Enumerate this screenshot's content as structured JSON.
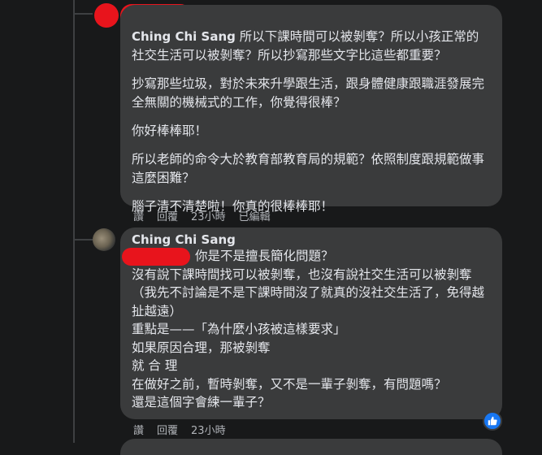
{
  "comments": [
    {
      "author": "Ching Chi Sang",
      "paragraphs": [
        "所以下課時間可以被剝奪？所以小孩正常的社交生活可以被剝奪？所以抄寫那些文字比這些都重要？",
        "抄寫那些垃圾，對於未來升學跟生活，跟身體健康跟職涯發展完全無關的機械式的工作，你覺得很棒？",
        "你好棒棒耶！",
        "所以老師的命令大於教育部教育局的規範？依照制度跟規範做事這麼困難？",
        "腦子清不清楚啦！你真的很棒棒耶！"
      ],
      "actions": {
        "like": "讚",
        "reply": "回覆",
        "time": "23小時",
        "edited": "已編輯"
      }
    },
    {
      "author": "Ching Chi Sang",
      "lines": [
        "你是不是擅長簡化問題？",
        "沒有說下課時間找可以被剝奪，也沒有說社交生活可以被剝奪（我先不討論是不是下課時間沒了就真的沒社交生活了，免得越扯越遠）",
        "重點是——「為什麼小孩被這樣要求」",
        "如果原因合理，那被剝奪",
        "就 合 理",
        "在做好之前，暫時剝奪，又不是一輩子剝奪，有問題嗎？",
        "還是這個字會練一輩子？"
      ],
      "actions": {
        "like": "讚",
        "reply": "回覆",
        "time": "23小時"
      }
    }
  ],
  "colors": {
    "background": "#18191a",
    "bubble": "#3a3b3c",
    "text": "#e4e6eb",
    "secondary": "#b0b3b8",
    "redaction": "#e8141c",
    "like": "#1877f2"
  },
  "icons": {
    "reaction": "like-icon"
  }
}
